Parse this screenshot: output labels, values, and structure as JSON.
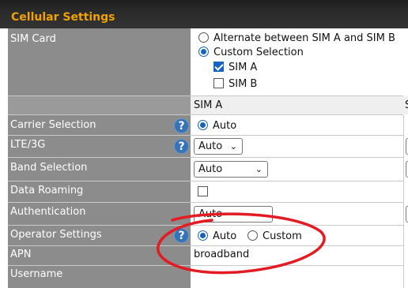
{
  "section": {
    "title": "Cellular Settings"
  },
  "sim_card": {
    "label": "SIM Card",
    "options": [
      "Alternate between SIM A and SIM B",
      "Custom Selection"
    ],
    "selected": "Custom Selection",
    "sims": [
      {
        "label": "SIM A",
        "checked": true
      },
      {
        "label": "SIM B",
        "checked": false
      }
    ]
  },
  "column_header": {
    "sim_a": "SIM A",
    "next_partial": "S"
  },
  "rows": {
    "carrier": {
      "label": "Carrier Selection",
      "value": "Auto"
    },
    "lte": {
      "label": "LTE/3G",
      "value": "Auto"
    },
    "band": {
      "label": "Band Selection",
      "value": "Auto"
    },
    "roaming": {
      "label": "Data Roaming",
      "checked": false
    },
    "auth": {
      "label": "Authentication",
      "value": "Auto"
    },
    "operator": {
      "label": "Operator Settings",
      "options": [
        "Auto",
        "Custom"
      ],
      "selected": "Auto"
    },
    "apn": {
      "label": "APN",
      "value": "broadband"
    },
    "username": {
      "label": "Username",
      "value": ""
    }
  },
  "icons": {
    "help": "?",
    "chevron": "⌄"
  },
  "colors": {
    "title": "#f2a200",
    "label_bg": "#8c8c8c",
    "accent": "#1565c0",
    "annotation": "#e31b23"
  }
}
